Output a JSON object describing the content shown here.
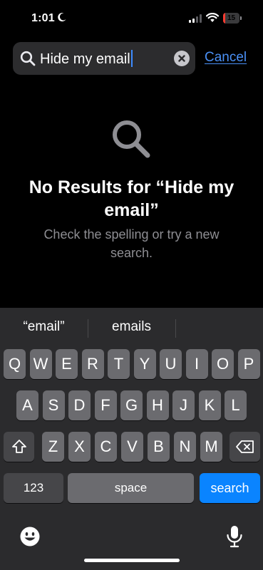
{
  "status_bar": {
    "time": "1:01",
    "battery_level": "15",
    "icons": [
      "moon-icon",
      "signal-icon",
      "wifi-icon",
      "battery-icon"
    ]
  },
  "search": {
    "query": "Hide my email",
    "cancel_label": "Cancel",
    "icons": [
      "search-icon",
      "clear-icon"
    ]
  },
  "empty_state": {
    "icon": "search-icon",
    "title": "No Results for “Hide my email”",
    "subtitle": "Check the spelling or try a new search."
  },
  "keyboard": {
    "suggestions": [
      "“email”",
      "emails",
      ""
    ],
    "row1": [
      "Q",
      "W",
      "E",
      "R",
      "T",
      "Y",
      "U",
      "I",
      "O",
      "P"
    ],
    "row2": [
      "A",
      "S",
      "D",
      "F",
      "G",
      "H",
      "J",
      "K",
      "L"
    ],
    "row3": [
      "Z",
      "X",
      "C",
      "V",
      "B",
      "N",
      "M"
    ],
    "numbers_label": "123",
    "space_label": "space",
    "search_label": "search",
    "icons": [
      "shift-icon",
      "backspace-icon",
      "emoji-icon",
      "microphone-icon"
    ]
  },
  "colors": {
    "accent": "#0a84ff",
    "link": "#4a90f6",
    "battery_low": "#ff3b30",
    "key": "#6b6b6f",
    "key_dark": "#464649",
    "keyboard_bg": "#2b2b2d"
  }
}
